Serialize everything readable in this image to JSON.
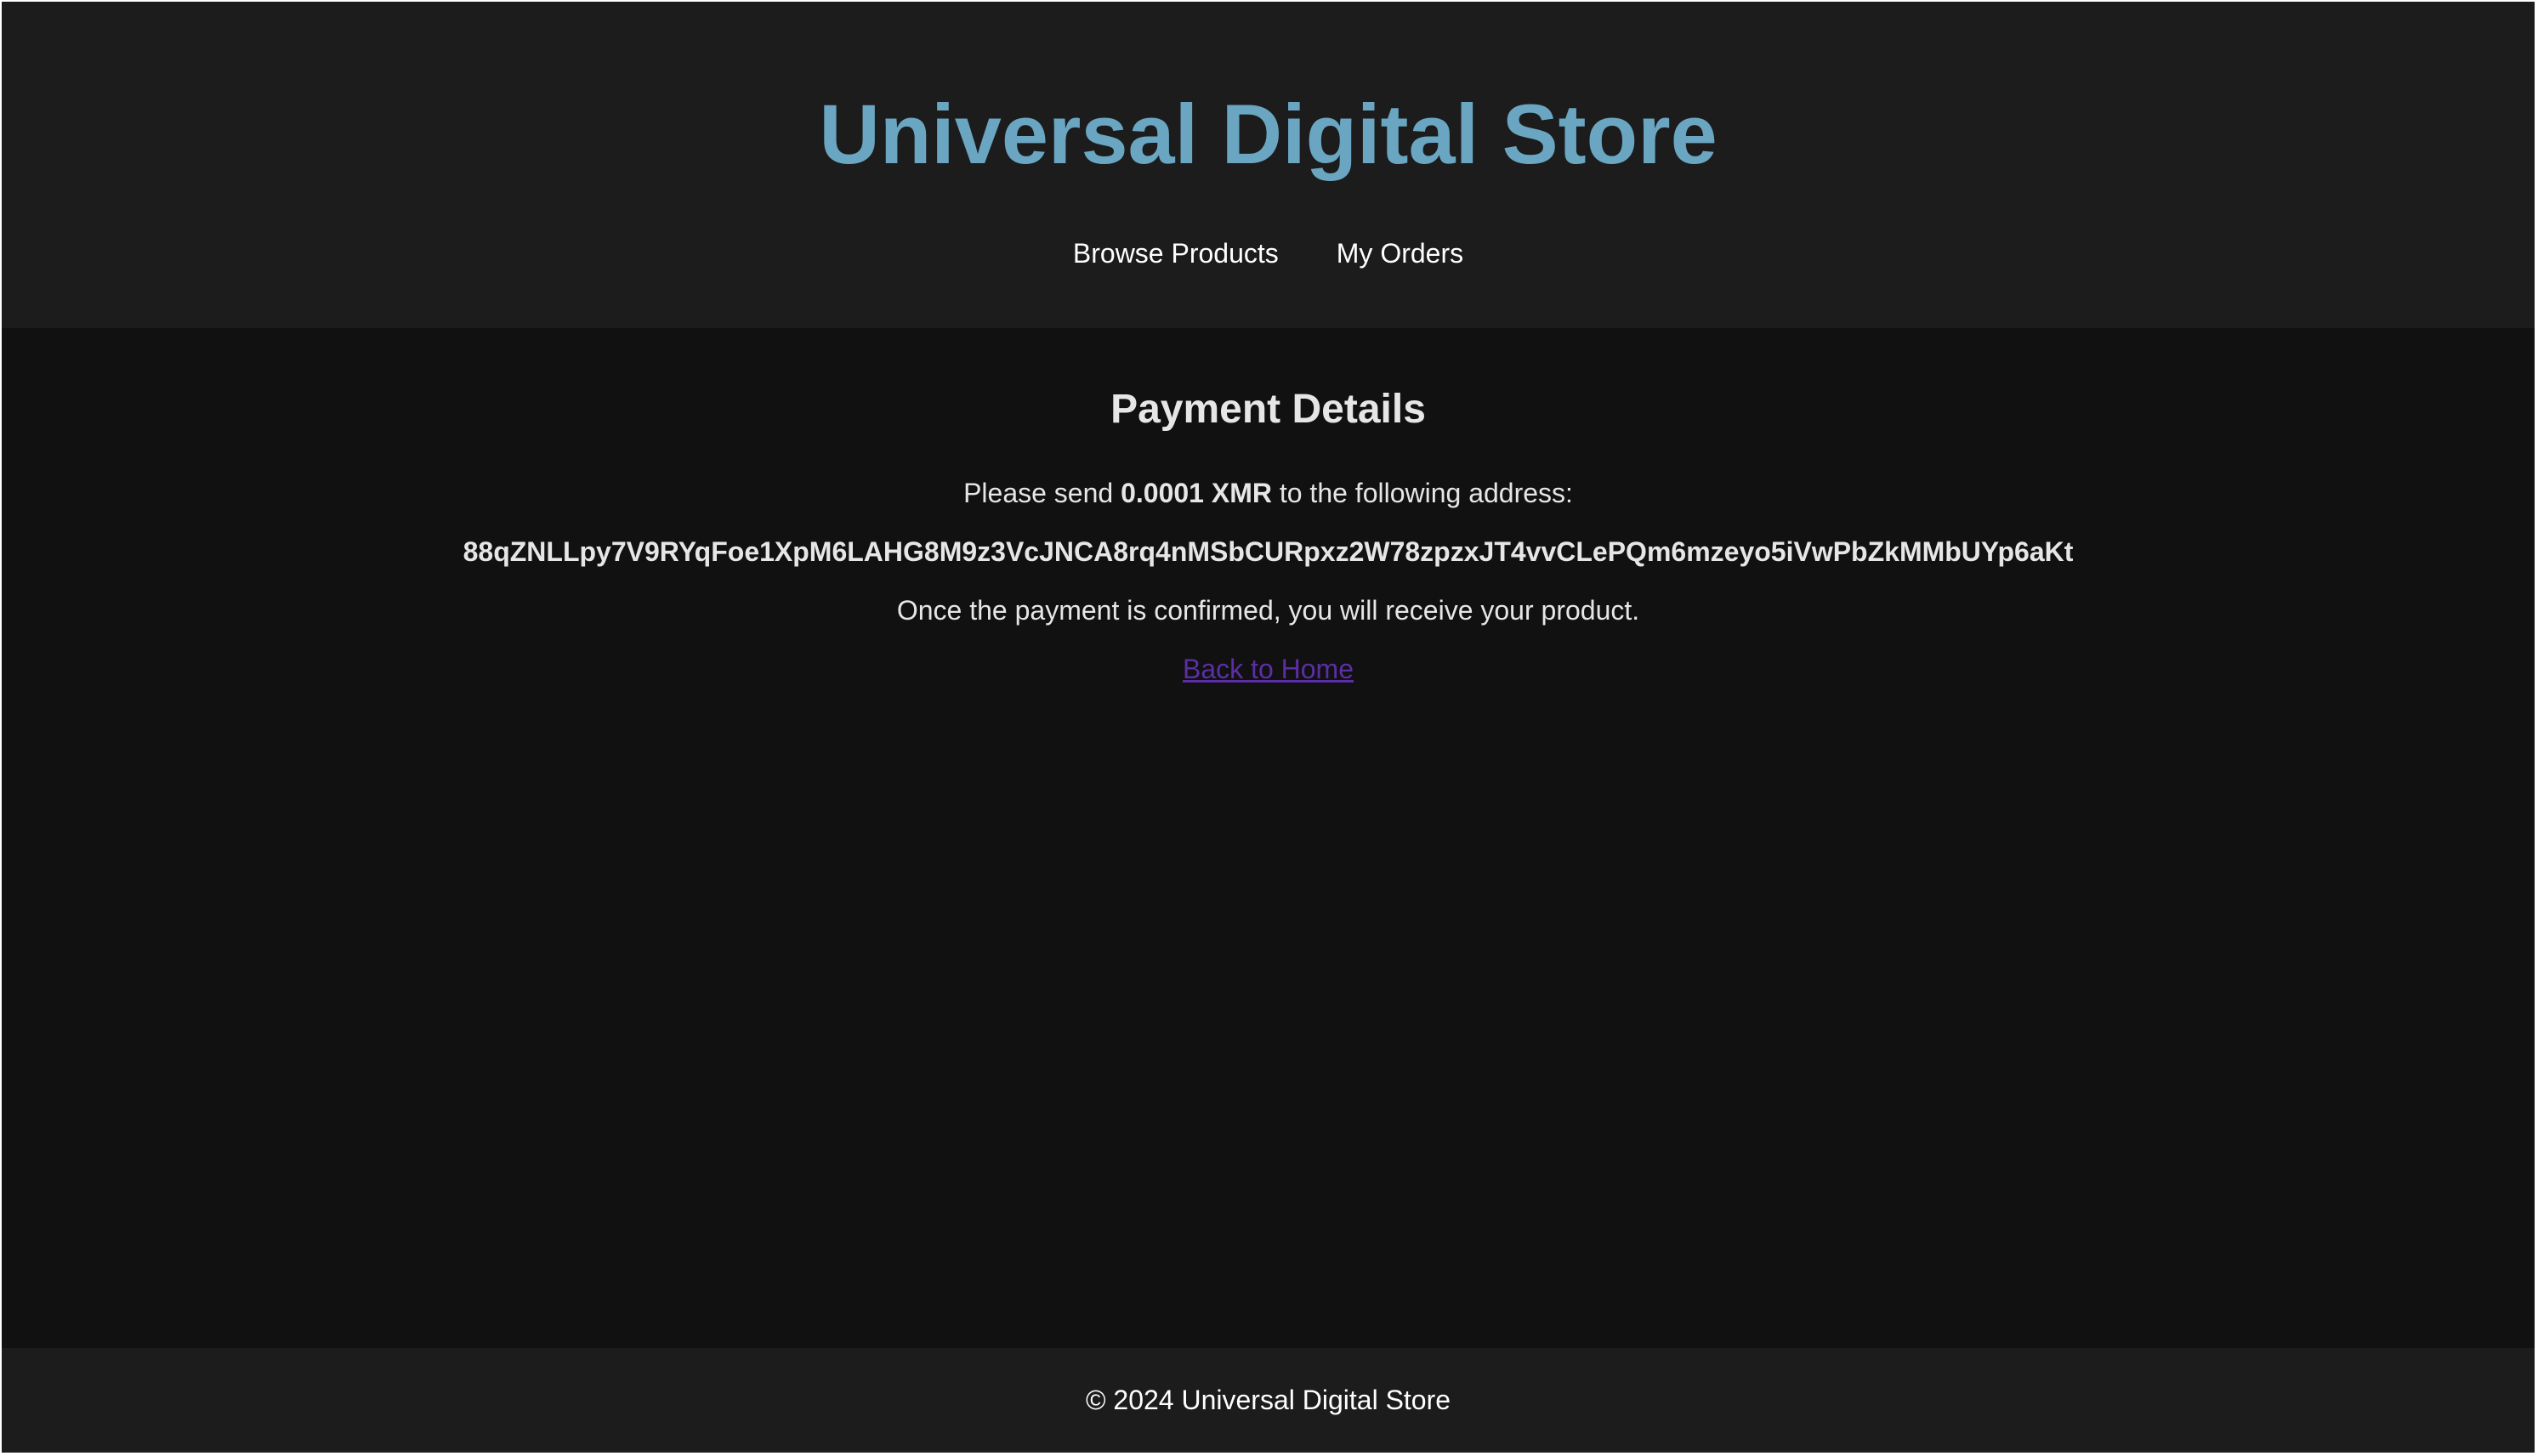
{
  "header": {
    "title": "Universal Digital Store",
    "nav": [
      {
        "label": "Browse Products"
      },
      {
        "label": "My Orders"
      }
    ]
  },
  "payment": {
    "heading": "Payment Details",
    "instruction_prefix": "Please send",
    "amount": "0.0001 XMR",
    "instruction_suffix": "to the following address:",
    "address": "88qZNLLpy7V9RYqFoe1XpM6LAHG8M9z3VcJNCA8rq4nMSbCURpxz2W78zpzxJT4vvCLePQm6mzeyo5iVwPbZkMMbUYp6aKt",
    "confirmation_text": "Once the payment is confirmed, you will receive your product.",
    "back_link": "Back to Home"
  },
  "footer": {
    "copyright": "© 2024 Universal Digital Store"
  },
  "colors": {
    "title": "#6aa6c2",
    "header_bg": "#1c1c1c",
    "page_bg": "#111111",
    "link": "#5b2ea6"
  }
}
